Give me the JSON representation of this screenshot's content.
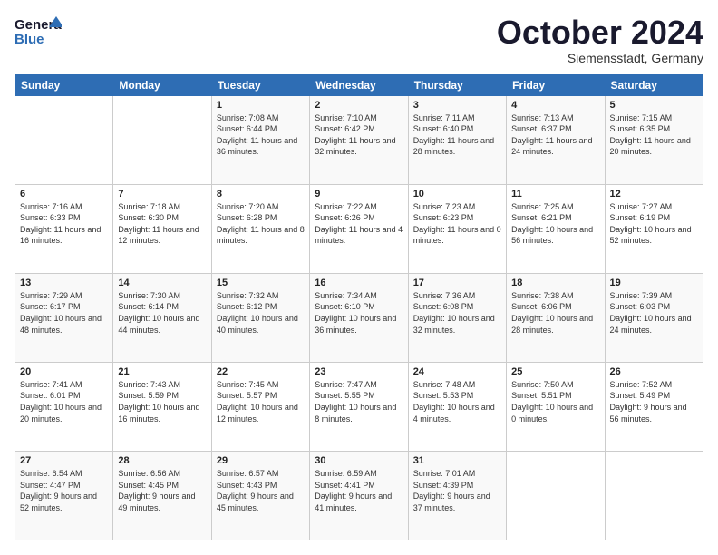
{
  "logo": {
    "line1": "General",
    "line2": "Blue"
  },
  "header": {
    "title": "October 2024",
    "subtitle": "Siemensstadt, Germany"
  },
  "days_of_week": [
    "Sunday",
    "Monday",
    "Tuesday",
    "Wednesday",
    "Thursday",
    "Friday",
    "Saturday"
  ],
  "weeks": [
    [
      {
        "day": "",
        "info": ""
      },
      {
        "day": "",
        "info": ""
      },
      {
        "day": "1",
        "info": "Sunrise: 7:08 AM\nSunset: 6:44 PM\nDaylight: 11 hours and 36 minutes."
      },
      {
        "day": "2",
        "info": "Sunrise: 7:10 AM\nSunset: 6:42 PM\nDaylight: 11 hours and 32 minutes."
      },
      {
        "day": "3",
        "info": "Sunrise: 7:11 AM\nSunset: 6:40 PM\nDaylight: 11 hours and 28 minutes."
      },
      {
        "day": "4",
        "info": "Sunrise: 7:13 AM\nSunset: 6:37 PM\nDaylight: 11 hours and 24 minutes."
      },
      {
        "day": "5",
        "info": "Sunrise: 7:15 AM\nSunset: 6:35 PM\nDaylight: 11 hours and 20 minutes."
      }
    ],
    [
      {
        "day": "6",
        "info": "Sunrise: 7:16 AM\nSunset: 6:33 PM\nDaylight: 11 hours and 16 minutes."
      },
      {
        "day": "7",
        "info": "Sunrise: 7:18 AM\nSunset: 6:30 PM\nDaylight: 11 hours and 12 minutes."
      },
      {
        "day": "8",
        "info": "Sunrise: 7:20 AM\nSunset: 6:28 PM\nDaylight: 11 hours and 8 minutes."
      },
      {
        "day": "9",
        "info": "Sunrise: 7:22 AM\nSunset: 6:26 PM\nDaylight: 11 hours and 4 minutes."
      },
      {
        "day": "10",
        "info": "Sunrise: 7:23 AM\nSunset: 6:23 PM\nDaylight: 11 hours and 0 minutes."
      },
      {
        "day": "11",
        "info": "Sunrise: 7:25 AM\nSunset: 6:21 PM\nDaylight: 10 hours and 56 minutes."
      },
      {
        "day": "12",
        "info": "Sunrise: 7:27 AM\nSunset: 6:19 PM\nDaylight: 10 hours and 52 minutes."
      }
    ],
    [
      {
        "day": "13",
        "info": "Sunrise: 7:29 AM\nSunset: 6:17 PM\nDaylight: 10 hours and 48 minutes."
      },
      {
        "day": "14",
        "info": "Sunrise: 7:30 AM\nSunset: 6:14 PM\nDaylight: 10 hours and 44 minutes."
      },
      {
        "day": "15",
        "info": "Sunrise: 7:32 AM\nSunset: 6:12 PM\nDaylight: 10 hours and 40 minutes."
      },
      {
        "day": "16",
        "info": "Sunrise: 7:34 AM\nSunset: 6:10 PM\nDaylight: 10 hours and 36 minutes."
      },
      {
        "day": "17",
        "info": "Sunrise: 7:36 AM\nSunset: 6:08 PM\nDaylight: 10 hours and 32 minutes."
      },
      {
        "day": "18",
        "info": "Sunrise: 7:38 AM\nSunset: 6:06 PM\nDaylight: 10 hours and 28 minutes."
      },
      {
        "day": "19",
        "info": "Sunrise: 7:39 AM\nSunset: 6:03 PM\nDaylight: 10 hours and 24 minutes."
      }
    ],
    [
      {
        "day": "20",
        "info": "Sunrise: 7:41 AM\nSunset: 6:01 PM\nDaylight: 10 hours and 20 minutes."
      },
      {
        "day": "21",
        "info": "Sunrise: 7:43 AM\nSunset: 5:59 PM\nDaylight: 10 hours and 16 minutes."
      },
      {
        "day": "22",
        "info": "Sunrise: 7:45 AM\nSunset: 5:57 PM\nDaylight: 10 hours and 12 minutes."
      },
      {
        "day": "23",
        "info": "Sunrise: 7:47 AM\nSunset: 5:55 PM\nDaylight: 10 hours and 8 minutes."
      },
      {
        "day": "24",
        "info": "Sunrise: 7:48 AM\nSunset: 5:53 PM\nDaylight: 10 hours and 4 minutes."
      },
      {
        "day": "25",
        "info": "Sunrise: 7:50 AM\nSunset: 5:51 PM\nDaylight: 10 hours and 0 minutes."
      },
      {
        "day": "26",
        "info": "Sunrise: 7:52 AM\nSunset: 5:49 PM\nDaylight: 9 hours and 56 minutes."
      }
    ],
    [
      {
        "day": "27",
        "info": "Sunrise: 6:54 AM\nSunset: 4:47 PM\nDaylight: 9 hours and 52 minutes."
      },
      {
        "day": "28",
        "info": "Sunrise: 6:56 AM\nSunset: 4:45 PM\nDaylight: 9 hours and 49 minutes."
      },
      {
        "day": "29",
        "info": "Sunrise: 6:57 AM\nSunset: 4:43 PM\nDaylight: 9 hours and 45 minutes."
      },
      {
        "day": "30",
        "info": "Sunrise: 6:59 AM\nSunset: 4:41 PM\nDaylight: 9 hours and 41 minutes."
      },
      {
        "day": "31",
        "info": "Sunrise: 7:01 AM\nSunset: 4:39 PM\nDaylight: 9 hours and 37 minutes."
      },
      {
        "day": "",
        "info": ""
      },
      {
        "day": "",
        "info": ""
      }
    ]
  ]
}
